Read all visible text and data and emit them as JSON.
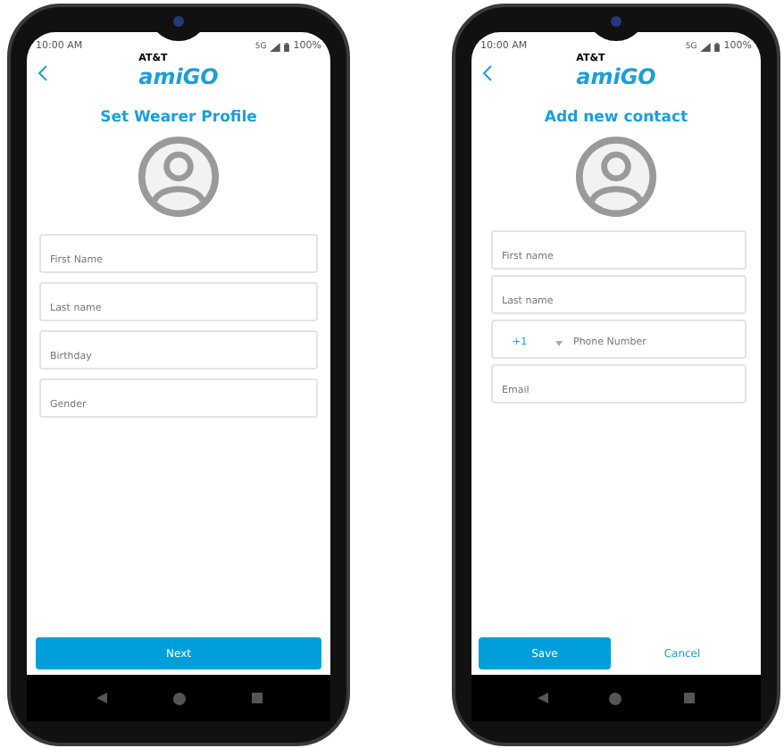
{
  "phones": [
    {
      "status_bar": {
        "time": "10:00 AM",
        "network": "5G",
        "battery": "100%"
      },
      "brand": "AT&T",
      "logo": "amiGO",
      "title": "Set Wearer Profile",
      "fields": [
        {
          "kind": "text",
          "placeholder": "First Name"
        },
        {
          "kind": "text",
          "placeholder": "Last name"
        },
        {
          "kind": "text",
          "placeholder": "Birthday"
        },
        {
          "kind": "text",
          "placeholder": "Gender"
        }
      ],
      "buttons": [
        {
          "kind": "primary",
          "label": "Next"
        }
      ]
    },
    {
      "status_bar": {
        "time": "10:00 AM",
        "network": "5G",
        "battery": "100%"
      },
      "brand": "AT&T",
      "logo": "amiGO",
      "title": "Add new contact",
      "fields": [
        {
          "kind": "text",
          "placeholder": "First name"
        },
        {
          "kind": "text",
          "placeholder": "Last name"
        },
        {
          "kind": "phone",
          "code": "+1",
          "placeholder": "Phone Number"
        },
        {
          "kind": "text",
          "placeholder": "Email"
        }
      ],
      "buttons": [
        {
          "kind": "primary",
          "label": "Save"
        },
        {
          "kind": "link",
          "label": "Cancel"
        }
      ]
    }
  ]
}
